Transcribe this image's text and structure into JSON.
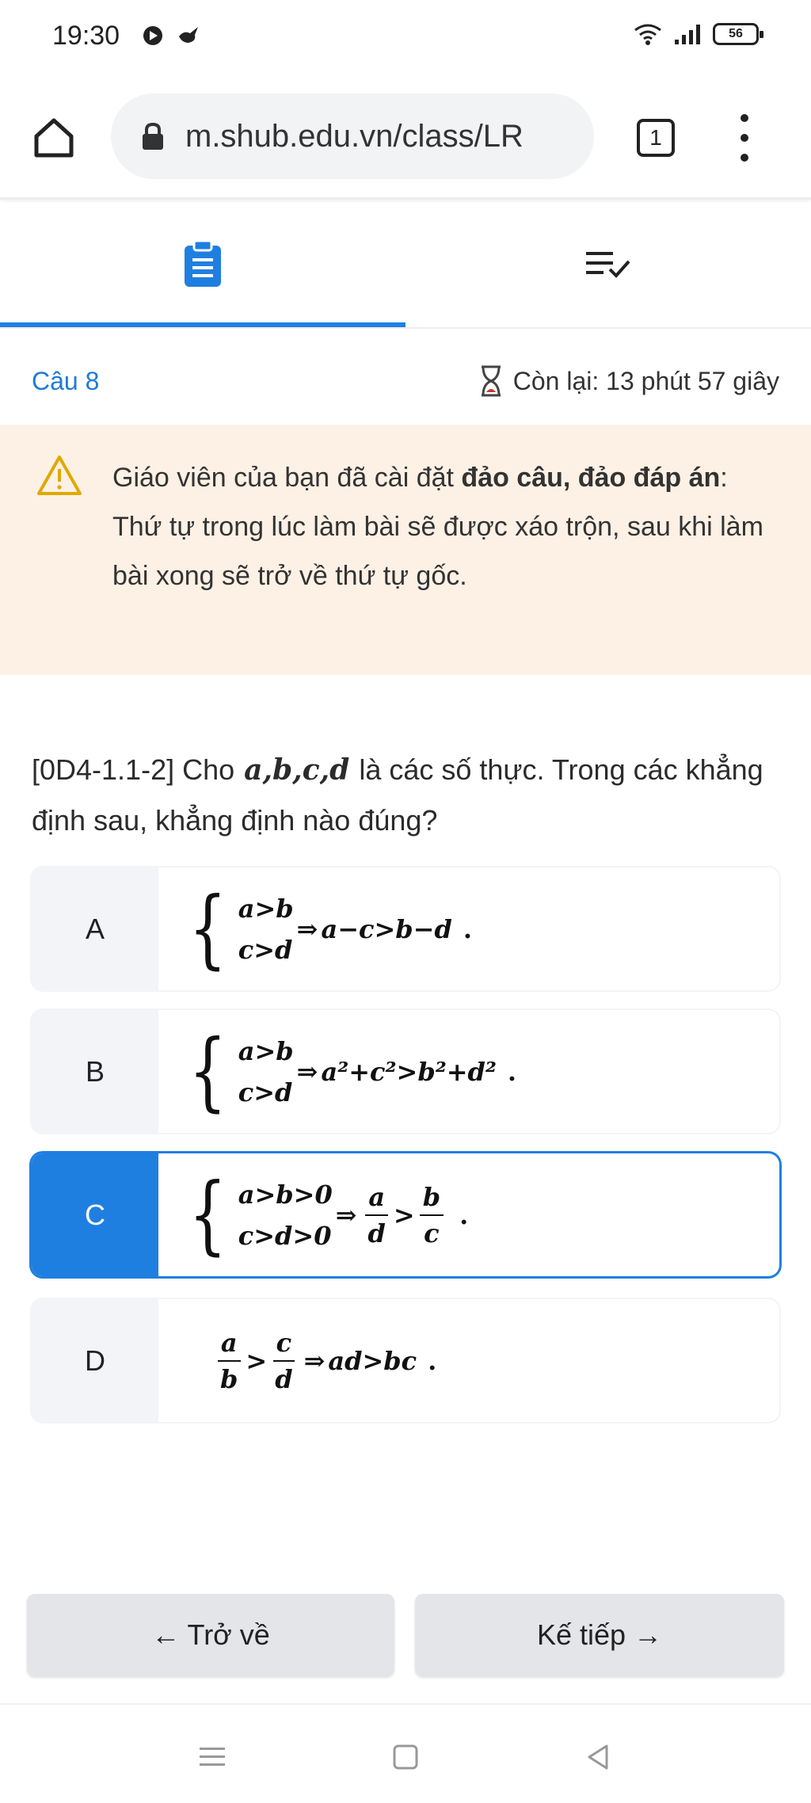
{
  "status_bar": {
    "time": "19:30",
    "battery": "56",
    "left_icons": [
      "media-icon",
      "bird-icon"
    ],
    "right_icons": [
      "wifi-icon",
      "signal-icon",
      "battery-icon"
    ]
  },
  "browser": {
    "url": "m.shub.edu.vn/class/LR",
    "tab_count": "1"
  },
  "tabs": [
    {
      "name": "clipboard-icon",
      "active": true
    },
    {
      "name": "checklist-icon",
      "active": false
    }
  ],
  "accent_color": "#1f7fe0",
  "question_header": {
    "number": "Câu 8",
    "timer": "Còn lại: 13 phút 57 giây"
  },
  "warning": {
    "text_before": "Giáo viên của bạn đã cài đặt ",
    "text_bold": "đảo câu, đảo đáp án",
    "text_after": ": Thứ tự trong lúc làm bài sẽ được xáo trộn, sau khi làm bài xong sẽ trở về thứ tự gốc."
  },
  "question": {
    "prefix": "[0D4-1.1-2] Cho",
    "vars": "a,b,c,d",
    "suffix": "là các số thực. Trong các khẳng định sau, khẳng định nào đúng?"
  },
  "options": {
    "a": {
      "letter": "A",
      "line1": "a>b",
      "line2": "c>d",
      "implies": "⇒",
      "result": "a−c>b−d",
      "end": "."
    },
    "b": {
      "letter": "B",
      "line1": "a>b",
      "line2": "c>d",
      "implies": "⇒",
      "result_html_text": "a²+c²>b²+d²",
      "end": "."
    },
    "c": {
      "letter": "C",
      "line1": "a>b>0",
      "line2": "c>d>0",
      "implies": "⇒",
      "frac1_num": "a",
      "frac1_den": "d",
      "gt": ">",
      "frac2_num": "b",
      "frac2_den": "c",
      "end": ".",
      "selected": true
    },
    "d": {
      "letter": "D",
      "frac1_num": "a",
      "frac1_den": "b",
      "gt": ">",
      "frac2_num": "c",
      "frac2_den": "d",
      "implies": "⇒",
      "result": "ad>bc",
      "end": "."
    }
  },
  "buttons": {
    "back": "← Trở về",
    "next": "Kế tiếp →"
  }
}
